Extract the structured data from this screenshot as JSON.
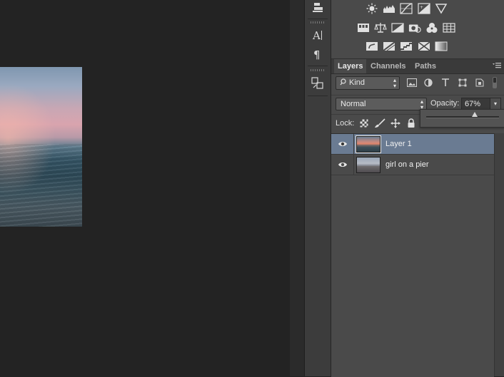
{
  "canvas": {
    "image_name": "canvas-image"
  },
  "tools": [
    "align-icon",
    "character-icon",
    "paragraph-icon",
    "glyphs-icon"
  ],
  "adjustments": {
    "row1": [
      "brightness-icon",
      "levels-icon",
      "curves-icon",
      "exposure-icon",
      "vibrance-icon"
    ],
    "row2": [
      "hue-sat-icon",
      "color-balance-icon",
      "black-white-icon",
      "photo-filter-icon",
      "channel-mixer-icon",
      "color-lookup-icon"
    ],
    "row3": [
      "invert-icon",
      "posterize-icon",
      "threshold-icon",
      "selective-color-icon",
      "gradient-map-icon"
    ]
  },
  "layers_panel": {
    "tabs": [
      {
        "label": "Layers",
        "active": true
      },
      {
        "label": "Channels",
        "active": false
      },
      {
        "label": "Paths",
        "active": false
      }
    ],
    "filter": {
      "kind_label": "Kind"
    },
    "blend_mode": "Normal",
    "opacity_label": "Opacity:",
    "opacity_value": "67%",
    "opacity_fraction": 0.67,
    "lock_label": "Lock:",
    "layers": [
      {
        "name": "Layer 1",
        "selected": true,
        "visible": true
      },
      {
        "name": "girl on a pier",
        "selected": false,
        "visible": true
      }
    ]
  },
  "colors": {
    "selection": "#6a7b92",
    "panel": "#4a4a4a",
    "background": "#232323"
  }
}
